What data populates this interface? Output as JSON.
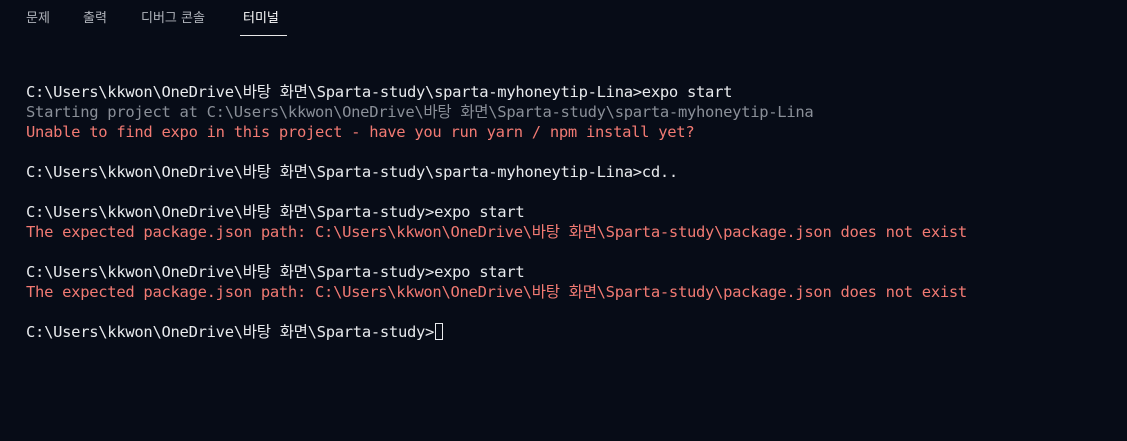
{
  "tabs": {
    "problems": "문제",
    "output": "출력",
    "debug_console": "디버그 콘솔",
    "terminal": "터미널"
  },
  "colors": {
    "background": "#070c17",
    "command_text": "#e8eaed",
    "dim_text": "#8a8f98",
    "error_text": "#f27a73"
  },
  "terminal": {
    "lines": [
      "C:\\Users\\kkwon\\OneDrive\\바탕 화면\\Sparta-study\\sparta-myhoneytip-Lina>expo start",
      "Starting project at C:\\Users\\kkwon\\OneDrive\\바탕 화면\\Sparta-study\\sparta-myhoneytip-Lina",
      "Unable to find expo in this project - have you run yarn / npm install yet?",
      "",
      "C:\\Users\\kkwon\\OneDrive\\바탕 화면\\Sparta-study\\sparta-myhoneytip-Lina>cd..",
      "",
      "C:\\Users\\kkwon\\OneDrive\\바탕 화면\\Sparta-study>expo start",
      "The expected package.json path: C:\\Users\\kkwon\\OneDrive\\바탕 화면\\Sparta-study\\package.json does not exist",
      "",
      "C:\\Users\\kkwon\\OneDrive\\바탕 화면\\Sparta-study>expo start",
      "The expected package.json path: C:\\Users\\kkwon\\OneDrive\\바탕 화면\\Sparta-study\\package.json does not exist",
      "",
      "C:\\Users\\kkwon\\OneDrive\\바탕 화면\\Sparta-study>"
    ]
  }
}
